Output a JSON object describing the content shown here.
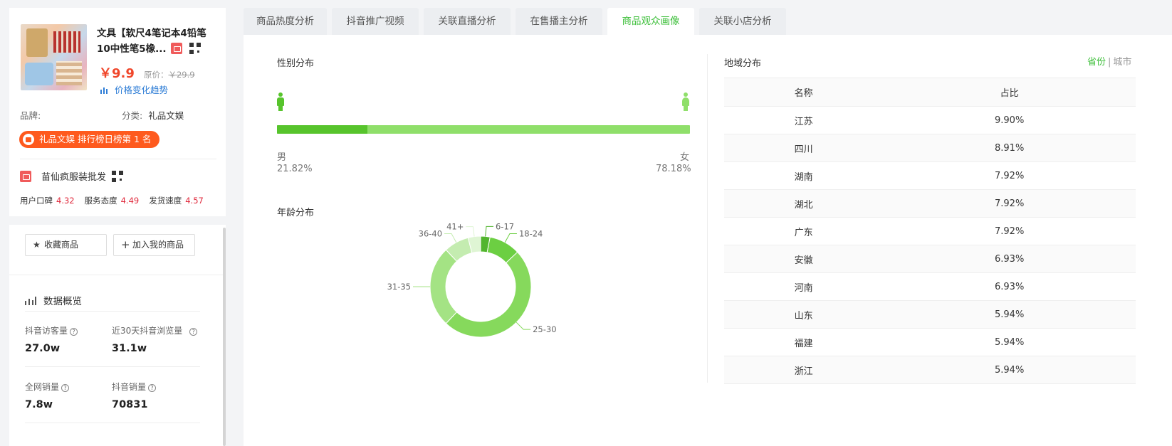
{
  "product": {
    "title_line1": "文具【软尺4笔记本4铅笔",
    "title_line2": "10中性笔5橡...",
    "price": "￥9.9",
    "orig_label": "原价：",
    "orig_price": "￥29.9",
    "trend_link": "价格变化趋势",
    "brand_label": "品牌:",
    "category_label": "分类:",
    "category_value": "礼品文娱",
    "rank_text": "礼品文娱 排行榜日榜第 1 名"
  },
  "store": {
    "name": "苗仙疯服装批发",
    "ratings": [
      {
        "label": "用户口碑",
        "value": "4.32"
      },
      {
        "label": "服务态度",
        "value": "4.49"
      },
      {
        "label": "发货速度",
        "value": "4.57"
      }
    ]
  },
  "actions": {
    "favorite_label": "收藏商品",
    "favorite_icon": "star-icon",
    "add_label": "加入我的商品",
    "add_icon": "plus-icon"
  },
  "overview": {
    "title": "数据概览",
    "kpis": [
      {
        "label": "抖音访客量",
        "value": "27.0w"
      },
      {
        "label": "近30天抖音浏览量",
        "value": "31.1w"
      },
      {
        "label": "全网销量",
        "value": "7.8w"
      },
      {
        "label": "抖音销量",
        "value": "70831"
      }
    ]
  },
  "tabs": [
    {
      "label": "商品热度分析"
    },
    {
      "label": "抖音推广视频"
    },
    {
      "label": "关联直播分析"
    },
    {
      "label": "在售播主分析"
    },
    {
      "label": "商品观众画像"
    },
    {
      "label": "关联小店分析"
    }
  ],
  "gender": {
    "title": "性别分布",
    "male_label": "男",
    "female_label": "女",
    "male_pct_text": "21.82%",
    "female_pct_text": "78.18%",
    "male_fraction": 0.2182,
    "male_color": "#57c42c",
    "female_color": "#8fdf6a"
  },
  "age": {
    "title": "年龄分布"
  },
  "chart_data": {
    "type": "pie",
    "categories": [
      "6-17",
      "18-24",
      "25-30",
      "31-35",
      "36-40",
      "41+"
    ],
    "values": [
      3,
      10,
      49,
      26,
      8,
      4
    ],
    "colors": [
      "#52b52e",
      "#6ccf42",
      "#86d95c",
      "#a4e384",
      "#c4ecb0",
      "#dff5d4"
    ]
  },
  "region": {
    "title": "地域分布",
    "toggle_province": "省份",
    "toggle_separator": "|",
    "toggle_city": "城市",
    "headers": [
      "名称",
      "占比"
    ],
    "rows": [
      {
        "name": "江苏",
        "pct": "9.90%"
      },
      {
        "name": "四川",
        "pct": "8.91%"
      },
      {
        "name": "湖南",
        "pct": "7.92%"
      },
      {
        "name": "湖北",
        "pct": "7.92%"
      },
      {
        "name": "广东",
        "pct": "7.92%"
      },
      {
        "name": "安徽",
        "pct": "6.93%"
      },
      {
        "name": "河南",
        "pct": "6.93%"
      },
      {
        "name": "山东",
        "pct": "5.94%"
      },
      {
        "name": "福建",
        "pct": "5.94%"
      },
      {
        "name": "浙江",
        "pct": "5.94%"
      }
    ]
  }
}
